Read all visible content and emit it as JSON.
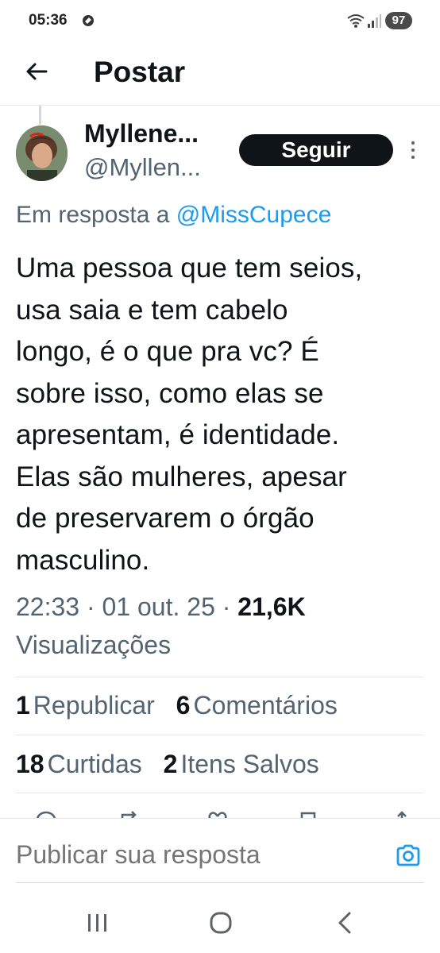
{
  "status_bar": {
    "time": "05:36",
    "battery": "97",
    "icons": [
      "dnd-icon",
      "wifi-icon",
      "signal-icon",
      "battery-icon"
    ]
  },
  "header": {
    "title": "Postar",
    "back_icon": "back-arrow-icon"
  },
  "post": {
    "author_name": "Myllene...",
    "author_handle": "@Myllen...",
    "follow_label": "Seguir",
    "reply_prefix": "Em resposta a",
    "reply_to": "@MissCupece",
    "text_lines": [
      "Uma pessoa que tem seios,",
      "usa saia e tem cabelo",
      "longo, é o que pra vc? É",
      "sobre isso, como elas se",
      "apresentam, é identidade.",
      "Elas são mulheres, apesar",
      "de preservarem o órgão",
      "masculino."
    ],
    "time": "22:33",
    "date": "01 out. 25",
    "views_count": "21,6K",
    "views_label": "Visualizações"
  },
  "stats": {
    "reposts": {
      "count": "1",
      "label": "Republicar"
    },
    "comments": {
      "count": "6",
      "label": "Comentários"
    },
    "likes": {
      "count": "18",
      "label": "Curtidas"
    },
    "bookmarks": {
      "count": "2",
      "label": "Itens Salvos"
    }
  },
  "reply_box": {
    "placeholder": "Publicar sua resposta",
    "camera_icon": "camera-icon"
  },
  "colors": {
    "text_primary": "#0f1419",
    "text_secondary": "#536471",
    "link": "#1d9bf0",
    "button_bg": "#0f1419",
    "divider": "#e6e9eb"
  }
}
